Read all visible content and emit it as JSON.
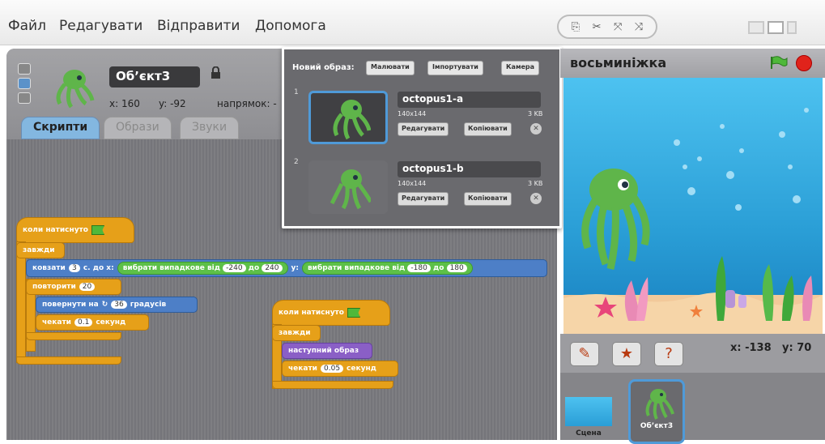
{
  "menu": {
    "file": "Файл",
    "edit": "Редагувати",
    "share": "Відправити",
    "help": "Допомога"
  },
  "toolbar": {
    "icons": [
      "duplicate-icon",
      "delete-icon",
      "grow-icon",
      "shrink-icon"
    ]
  },
  "sprite": {
    "name": "Об’єкт3",
    "x_label": "x: 160",
    "y_label": "y: -92",
    "direction_label": "напрямок: -"
  },
  "tabs": {
    "scripts": "Скрипти",
    "costumes": "Образи",
    "sounds": "Звуки"
  },
  "scripts": {
    "when_flag": "коли натиснуто",
    "forever": "завжди",
    "glide": "ковзати",
    "glide_secs": "3",
    "glide_to_x": "с. до х:",
    "pick_random": "вибрати випадкове від",
    "to": "до",
    "r1_from": "-240",
    "r1_to": "240",
    "y_label": "у:",
    "r2_from": "-180",
    "r2_to": "180",
    "repeat": "повторити",
    "repeat_n": "20",
    "turn": "повернути на",
    "turn_deg": "36",
    "degrees": "градусів",
    "wait": "чекати",
    "wait1": "0.1",
    "seconds": "секунд",
    "when_flag2": "коли натиснуто",
    "forever2": "завжди",
    "next_costume": "наступний образ",
    "wait2_label": "чекати",
    "wait2": "0.05",
    "seconds2": "секунд"
  },
  "costumes_popup": {
    "new_costume": "Новий образ:",
    "paint": "Малювати",
    "import": "Імпортувати",
    "camera": "Камера",
    "items": [
      {
        "index": "1",
        "name": "octopus1-a",
        "dims": "140x144",
        "size": "3 KB",
        "edit": "Редагувати",
        "copy": "Копіювати"
      },
      {
        "index": "2",
        "name": "octopus1-b",
        "dims": "140x144",
        "size": "3 KB",
        "edit": "Редагувати",
        "copy": "Копіювати"
      }
    ]
  },
  "stage": {
    "title": "восьминіжка",
    "mouse_x": "x: -138",
    "mouse_y": "y: 70"
  },
  "sprite_list": {
    "sprite": "Об’єкт3",
    "stage": "Сцена"
  },
  "colors": {
    "control": "#e6a019",
    "motion": "#4d7fc7",
    "looks": "#8a5fc6",
    "operators": "#5dc048",
    "selected": "#4f9ad8"
  }
}
